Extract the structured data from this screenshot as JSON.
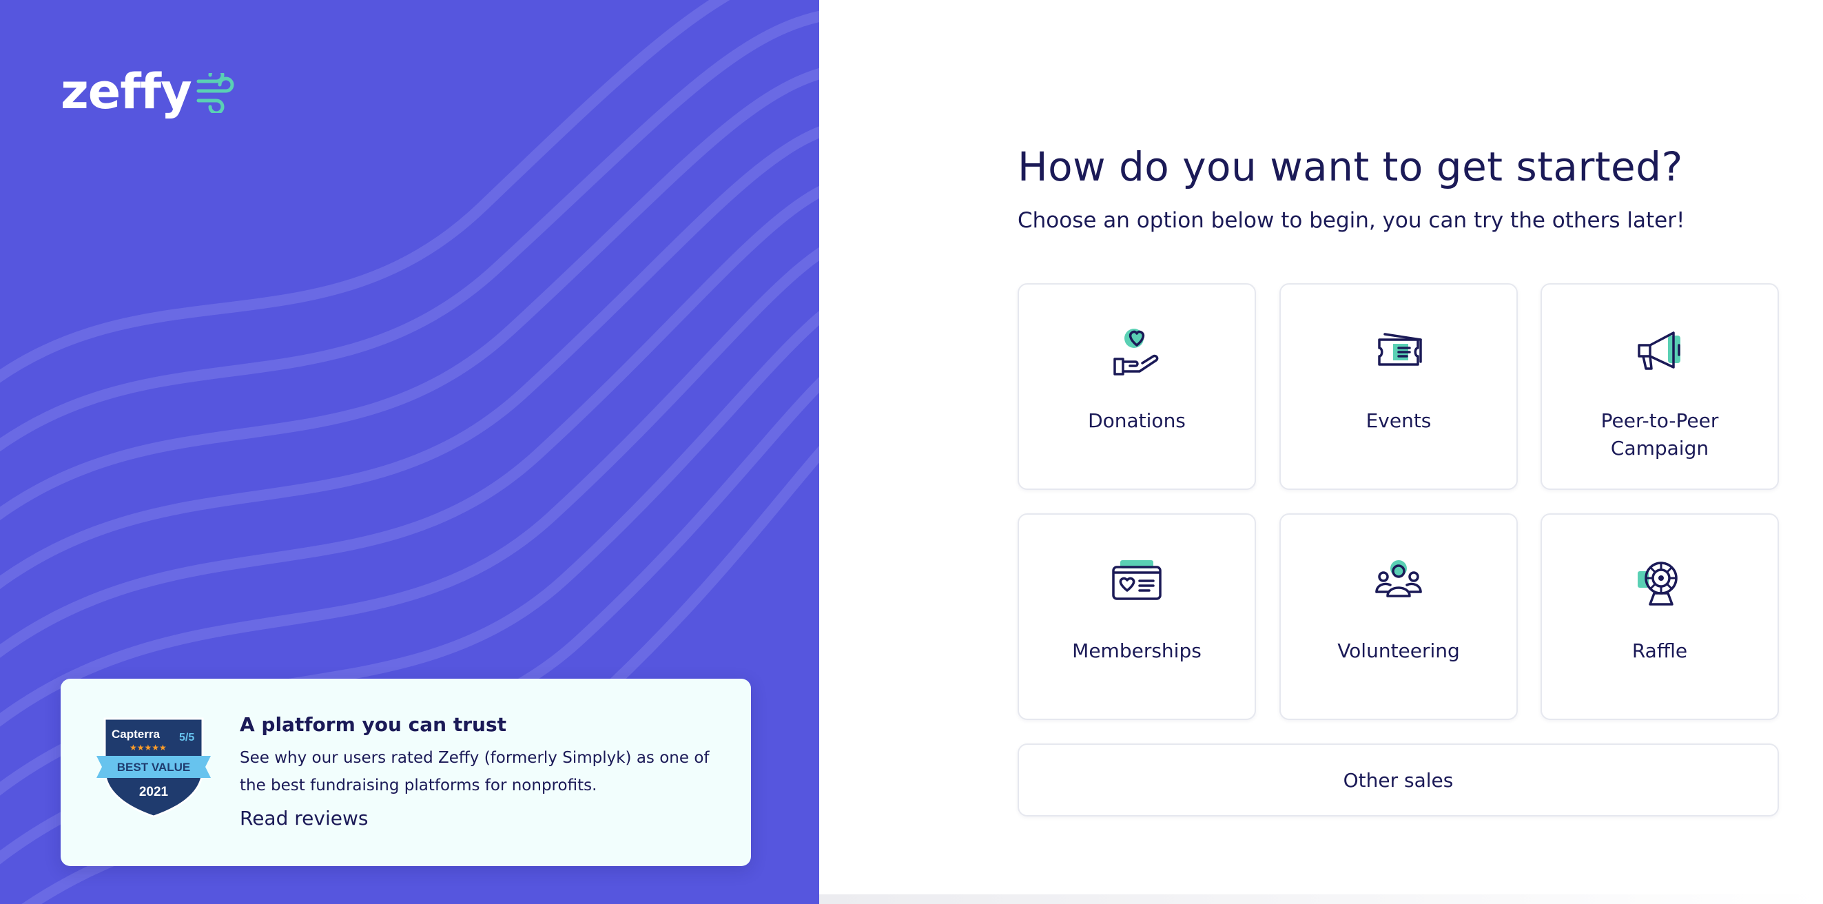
{
  "brand": {
    "logo_text": "zeffy",
    "primary_color": "#5656de",
    "accent_color": "#5ad0b4",
    "text_color": "#1b1a57"
  },
  "trust_card": {
    "title": "A platform you can trust",
    "description": "See why our users rated Zeffy (formerly Simplyk) as one of the best fundraising platforms for nonprofits.",
    "link_label": "Read reviews",
    "badge": {
      "brand": "Capterra",
      "rating": "5/5",
      "award": "BEST VALUE",
      "year": "2021"
    }
  },
  "onboarding": {
    "title": "How do you want to get started?",
    "subtitle": "Choose an option below to begin, you can try the others later!",
    "options": [
      {
        "label": "Donations",
        "icon": "heart-hand-icon"
      },
      {
        "label": "Events",
        "icon": "ticket-icon"
      },
      {
        "label": "Peer-to-Peer Campaign",
        "icon": "megaphone-icon"
      },
      {
        "label": "Memberships",
        "icon": "membership-card-icon"
      },
      {
        "label": "Volunteering",
        "icon": "people-group-icon"
      },
      {
        "label": "Raffle",
        "icon": "raffle-wheel-icon"
      }
    ],
    "other_label": "Other sales"
  }
}
